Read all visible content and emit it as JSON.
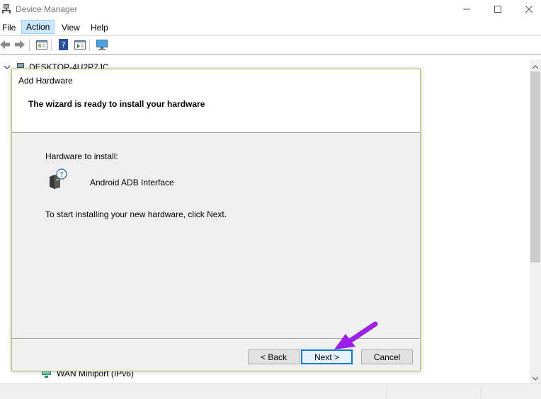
{
  "window": {
    "title": "Device Manager",
    "controls": [
      "minimize",
      "maximize",
      "close"
    ]
  },
  "menu": {
    "items": [
      {
        "label": "File"
      },
      {
        "label": "Action",
        "active": true
      },
      {
        "label": "View"
      },
      {
        "label": "Help"
      }
    ]
  },
  "toolbar": {
    "buttons": [
      "back-arrow-icon",
      "forward-arrow-icon",
      "properties-icon",
      "help-icon",
      "view-icon",
      "monitor-icon"
    ]
  },
  "tree": {
    "root_label": "DESKTOP-4U2P7JC",
    "visible_node": "WAN Miniport (IPv6)"
  },
  "dialog": {
    "caption": "Add Hardware",
    "heading": "The wizard is ready to install your hardware",
    "hardware_label": "Hardware to install:",
    "hardware_name": "Android ADB Interface",
    "instruction": "To start installing your new hardware, click Next.",
    "buttons": {
      "back": "< Back",
      "next": "Next >",
      "cancel": "Cancel"
    }
  },
  "colors": {
    "accent": "#0078d7",
    "dialog_border": "#b6c15d",
    "annotation_arrow": "#9b1fe8"
  }
}
